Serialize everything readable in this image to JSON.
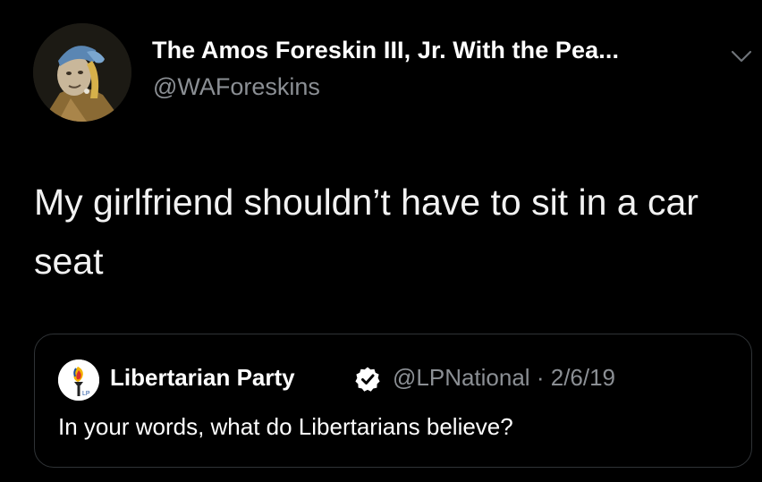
{
  "tweet": {
    "author_name": "The Amos Foreskin III, Jr. With the Pea...",
    "author_handle": "@WAForeskins",
    "text": "My girlfriend shouldn’t have to sit in a car seat",
    "icons": {
      "avatar": "avatar-image",
      "menu": "chevron-down-icon"
    }
  },
  "quote": {
    "author_name": "Libertarian Party",
    "author_handle": "@LPNational",
    "separator": "·",
    "date": "2/6/19",
    "text": "In your words, what do Libertarians believe?",
    "icons": {
      "avatar": "torch-logo",
      "badge": "verified-badge-icon"
    }
  },
  "colors": {
    "background": "#000000",
    "primary_text": "#ffffff",
    "secondary_text": "#8b8f94",
    "card_border": "#2f3336"
  }
}
